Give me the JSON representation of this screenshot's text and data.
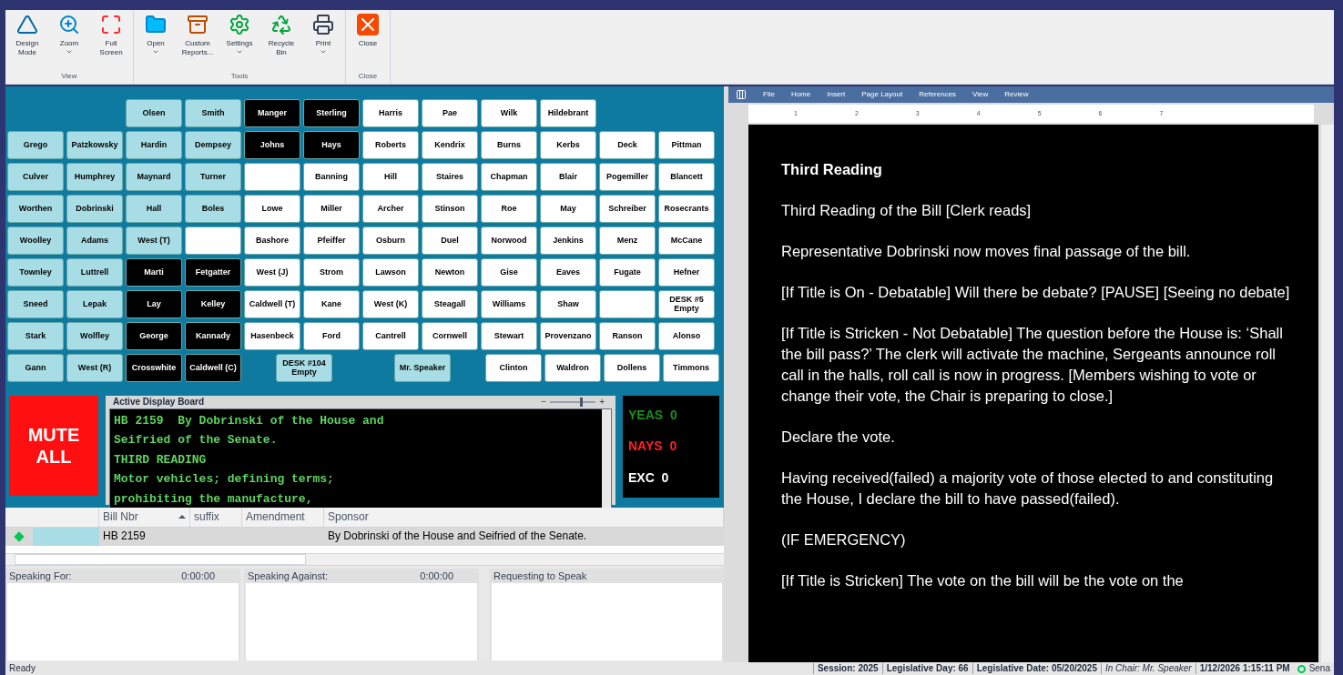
{
  "toolbar": {
    "groups": [
      {
        "label": "View",
        "tools": [
          {
            "label": "Design Mode",
            "has_menu": false
          },
          {
            "label": "Zoom",
            "has_menu": true
          },
          {
            "label": "Full Screen",
            "has_menu": false
          }
        ]
      },
      {
        "label": "Tools",
        "tools": [
          {
            "label": "Open",
            "has_menu": true
          },
          {
            "label": "Custom Reports...",
            "has_menu": false
          },
          {
            "label": "Settings",
            "has_menu": true
          },
          {
            "label": "Recycle Bin",
            "has_menu": false
          },
          {
            "label": "Print",
            "has_menu": true
          }
        ]
      },
      {
        "label": "Close",
        "tools": [
          {
            "label": "Close",
            "has_menu": false
          }
        ]
      }
    ]
  },
  "seat_rows": [
    [
      {
        "kind": "space"
      },
      {
        "kind": "space"
      },
      {
        "kind": "light",
        "name": "Olsen"
      },
      {
        "kind": "light",
        "name": "Smith"
      },
      {
        "kind": "dark",
        "name": "Manger"
      },
      {
        "kind": "dark",
        "name": "Sterling"
      },
      {
        "kind": "white",
        "name": "Harris"
      },
      {
        "kind": "white",
        "name": "Pae"
      },
      {
        "kind": "white",
        "name": "Wilk"
      },
      {
        "kind": "white",
        "name": "Hildebrant"
      }
    ],
    [
      {
        "kind": "light",
        "name": "Grego"
      },
      {
        "kind": "light",
        "name": "Patzkowsky"
      },
      {
        "kind": "light",
        "name": "Hardin"
      },
      {
        "kind": "light",
        "name": "Dempsey"
      },
      {
        "kind": "dark",
        "name": "Johns"
      },
      {
        "kind": "dark",
        "name": "Hays"
      },
      {
        "kind": "white",
        "name": "Roberts"
      },
      {
        "kind": "white",
        "name": "Kendrix"
      },
      {
        "kind": "white",
        "name": "Burns"
      },
      {
        "kind": "white",
        "name": "Kerbs"
      },
      {
        "kind": "white",
        "name": "Deck"
      },
      {
        "kind": "white",
        "name": "Pittman"
      }
    ],
    [
      {
        "kind": "light",
        "name": "Culver"
      },
      {
        "kind": "light",
        "name": "Humphrey"
      },
      {
        "kind": "light",
        "name": "Maynard"
      },
      {
        "kind": "light",
        "name": "Turner"
      },
      {
        "kind": "blank"
      },
      {
        "kind": "white",
        "name": "Banning"
      },
      {
        "kind": "white",
        "name": "Hill"
      },
      {
        "kind": "white",
        "name": "Staires"
      },
      {
        "kind": "white",
        "name": "Chapman"
      },
      {
        "kind": "white",
        "name": "Blair"
      },
      {
        "kind": "white",
        "name": "Pogemiller"
      },
      {
        "kind": "white",
        "name": "Blancett"
      }
    ],
    [
      {
        "kind": "light",
        "name": "Worthen"
      },
      {
        "kind": "light",
        "name": "Dobrinski"
      },
      {
        "kind": "light",
        "name": "Hall"
      },
      {
        "kind": "light",
        "name": "Boles"
      },
      {
        "kind": "white",
        "name": "Lowe"
      },
      {
        "kind": "white",
        "name": "Miller"
      },
      {
        "kind": "white",
        "name": "Archer"
      },
      {
        "kind": "white",
        "name": "Stinson"
      },
      {
        "kind": "white",
        "name": "Roe"
      },
      {
        "kind": "white",
        "name": "May"
      },
      {
        "kind": "white",
        "name": "Schreiber"
      },
      {
        "kind": "white",
        "name": "Rosecrants"
      }
    ],
    [
      {
        "kind": "light",
        "name": "Woolley"
      },
      {
        "kind": "light",
        "name": "Adams"
      },
      {
        "kind": "light",
        "name": "West (T)"
      },
      {
        "kind": "blank"
      },
      {
        "kind": "white",
        "name": "Bashore"
      },
      {
        "kind": "white",
        "name": "Pfeiffer"
      },
      {
        "kind": "white",
        "name": "Osburn"
      },
      {
        "kind": "white",
        "name": "Duel"
      },
      {
        "kind": "white",
        "name": "Norwood"
      },
      {
        "kind": "white",
        "name": "Jenkins"
      },
      {
        "kind": "white",
        "name": "Menz"
      },
      {
        "kind": "white",
        "name": "McCane"
      }
    ],
    [
      {
        "kind": "light",
        "name": "Townley"
      },
      {
        "kind": "light",
        "name": "Luttrell"
      },
      {
        "kind": "dark",
        "name": "Marti"
      },
      {
        "kind": "dark",
        "name": "Fetgatter"
      },
      {
        "kind": "white",
        "name": "West (J)"
      },
      {
        "kind": "white",
        "name": "Strom"
      },
      {
        "kind": "white",
        "name": "Lawson"
      },
      {
        "kind": "white",
        "name": "Newton"
      },
      {
        "kind": "white",
        "name": "Gise"
      },
      {
        "kind": "white",
        "name": "Eaves"
      },
      {
        "kind": "white",
        "name": "Fugate"
      },
      {
        "kind": "white",
        "name": "Hefner"
      }
    ],
    [
      {
        "kind": "light",
        "name": "Sneed"
      },
      {
        "kind": "light",
        "name": "Lepak"
      },
      {
        "kind": "dark",
        "name": "Lay"
      },
      {
        "kind": "dark",
        "name": "Kelley"
      },
      {
        "kind": "white",
        "name": "Caldwell (T)"
      },
      {
        "kind": "white",
        "name": "Kane"
      },
      {
        "kind": "white",
        "name": "West (K)"
      },
      {
        "kind": "white",
        "name": "Steagall"
      },
      {
        "kind": "white",
        "name": "Williams"
      },
      {
        "kind": "white",
        "name": "Shaw"
      },
      {
        "kind": "blank"
      },
      {
        "kind": "white",
        "name": "DESK #5 Empty"
      }
    ],
    [
      {
        "kind": "light",
        "name": "Stark"
      },
      {
        "kind": "light",
        "name": "Wolfley"
      },
      {
        "kind": "dark",
        "name": "George"
      },
      {
        "kind": "dark",
        "name": "Kannady"
      },
      {
        "kind": "white",
        "name": "Hasenbeck"
      },
      {
        "kind": "white",
        "name": "Ford"
      },
      {
        "kind": "white",
        "name": "Cantrell"
      },
      {
        "kind": "white",
        "name": "Cornwell"
      },
      {
        "kind": "white",
        "name": "Stewart"
      },
      {
        "kind": "white",
        "name": "Provenzano"
      },
      {
        "kind": "white",
        "name": "Ranson"
      },
      {
        "kind": "white",
        "name": "Alonso"
      }
    ],
    [
      {
        "kind": "light",
        "name": "Gann"
      },
      {
        "kind": "light",
        "name": "West (R)"
      },
      {
        "kind": "dark",
        "name": "Crosswhite"
      },
      {
        "kind": "dark",
        "name": "Caldwell (C)"
      },
      {
        "kind": "half-space"
      },
      {
        "kind": "light",
        "name": "DESK #104 Empty"
      },
      {
        "kind": "space"
      },
      {
        "kind": "light",
        "name": "Mr. Speaker"
      },
      {
        "kind": "half-space"
      },
      {
        "kind": "white",
        "name": "Clinton"
      },
      {
        "kind": "white",
        "name": "Waldron"
      },
      {
        "kind": "white",
        "name": "Dollens"
      },
      {
        "kind": "white",
        "name": "Timmons"
      }
    ]
  ],
  "mute_button": "MUTE ALL",
  "display_board": {
    "title": "Active Display Board",
    "zoom_minus": "−",
    "zoom_plus": "+",
    "zoom_slider": {
      "level": 0.7
    },
    "lines": [
      "HB 2159  By Dobrinski of the House and",
      "Seifried of the Senate.",
      "THIRD READING",
      "Motor vehicles; defining terms;",
      "prohibiting the manufacture,"
    ]
  },
  "tallies": [
    {
      "label": "YEAS",
      "count": "0",
      "color": "#1a8f1a"
    },
    {
      "label": "NAYS",
      "count": "0",
      "color": "#ff2020"
    },
    {
      "label": "EXC",
      "count": "0",
      "color": "#ffffff"
    }
  ],
  "bill_table": {
    "columns": [
      {
        "label": "Bill Nbr",
        "sorted": true
      },
      {
        "label": "suffix",
        "sorted": false
      },
      {
        "label": "Amendment",
        "sorted": false
      },
      {
        "label": "Sponsor",
        "sorted": false
      }
    ],
    "rows": [
      {
        "bill_nbr": "HB 2159",
        "sponsor": "By Dobrinski of the House and Seifried of the Senate.",
        "current": true
      }
    ]
  },
  "speaking_panels": [
    {
      "title": "Speaking For:",
      "time": "0:00:00"
    },
    {
      "title": "Speaking Against:",
      "time": "0:00:00"
    },
    {
      "title": "Requesting to Speak"
    }
  ],
  "document": {
    "menu": [
      "File",
      "Home",
      "Insert",
      "Page Layout",
      "References",
      "View",
      "Review"
    ],
    "ruler": [
      "1",
      "2",
      "3",
      "4",
      "5",
      "6",
      "7"
    ],
    "paragraphs": [
      {
        "kind": "heading",
        "text": "Third Reading"
      },
      {
        "kind": "text",
        "text": "Third Reading of the Bill [Clerk reads]"
      },
      {
        "kind": "text",
        "text": "Representative Dobrinski now moves final passage of the bill."
      },
      {
        "kind": "text",
        "text": "[If Title is On - Debatable] Will there be debate? [PAUSE]  [Seeing no debate]"
      },
      {
        "kind": "text",
        "text": "[If Title is Stricken - Not Debatable] The question before the House is: ‘Shall the bill pass?’  The clerk will activate the machine, Sergeants announce roll call in the halls, roll call is now in progress. [Members wishing to vote or change their vote, the Chair is preparing to close.]"
      },
      {
        "kind": "text",
        "text": "Declare the vote."
      },
      {
        "kind": "text",
        "text": "Having received(failed) a majority vote of those elected to and constituting the House, I declare the bill to have passed(failed)."
      },
      {
        "kind": "text",
        "text": "(IF EMERGENCY)"
      },
      {
        "kind": "text",
        "text": "[If Title is Stricken] The vote on the bill will be the vote on the"
      }
    ]
  },
  "status_bar": {
    "left": "Ready",
    "segments": [
      {
        "text": "Session: 2025",
        "italic": false
      },
      {
        "text": "Legislative Day: 66",
        "italic": false
      },
      {
        "text": "Legislative Date: 05/20/2025",
        "italic": false
      },
      {
        "text": "In Chair: Mr. Speaker",
        "italic": true
      },
      {
        "text": "1/12/2026 1:15:11 PM",
        "italic": false
      }
    ],
    "indicator": "Sena"
  }
}
